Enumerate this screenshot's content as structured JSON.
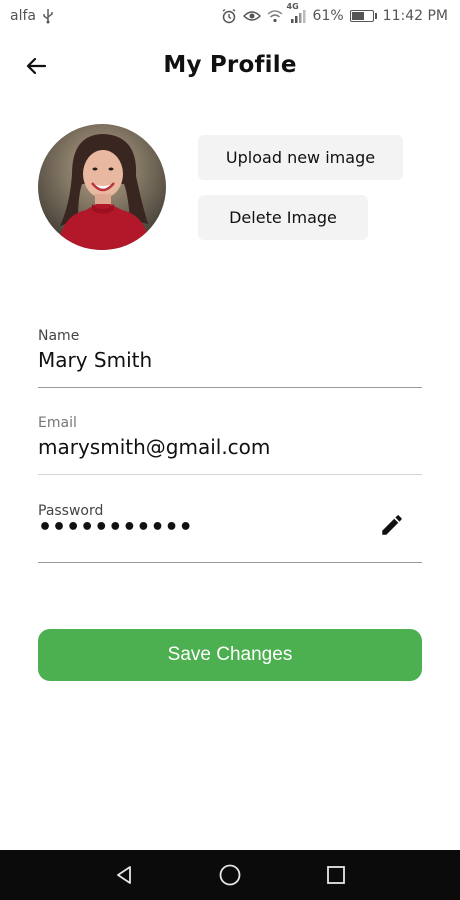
{
  "status_bar": {
    "carrier": "alfa",
    "usb_icon": "usb-icon",
    "alarm_icon": "alarm-icon",
    "eye_icon": "eye-comfort-icon",
    "wifi_icon": "wifi-icon",
    "network_type": "4G",
    "signal_icon": "signal-icon",
    "battery_percent": "61%",
    "battery_level": 0.61,
    "time": "11:42 PM"
  },
  "header": {
    "back_icon": "back-arrow-icon",
    "title": "My Profile"
  },
  "avatar": {
    "description_icon": "profile-photo"
  },
  "image_actions": {
    "upload_label": "Upload new image",
    "delete_label": "Delete Image"
  },
  "form": {
    "name": {
      "label": "Name",
      "value": "Mary Smith"
    },
    "email": {
      "label": "Email",
      "value": "marysmith@gmail.com"
    },
    "password": {
      "label": "Password",
      "value": "•••••••••••",
      "edit_icon": "pencil-icon"
    }
  },
  "save_button": {
    "label": "Save Changes",
    "color": "#4caf50"
  },
  "nav_bar": {
    "back_icon": "triangle-back-icon",
    "home_icon": "circle-home-icon",
    "recents_icon": "square-recents-icon"
  },
  "colors": {
    "accent": "#4caf50",
    "button_bg": "#f3f3f3",
    "nav_bg": "#0b0b0b"
  }
}
